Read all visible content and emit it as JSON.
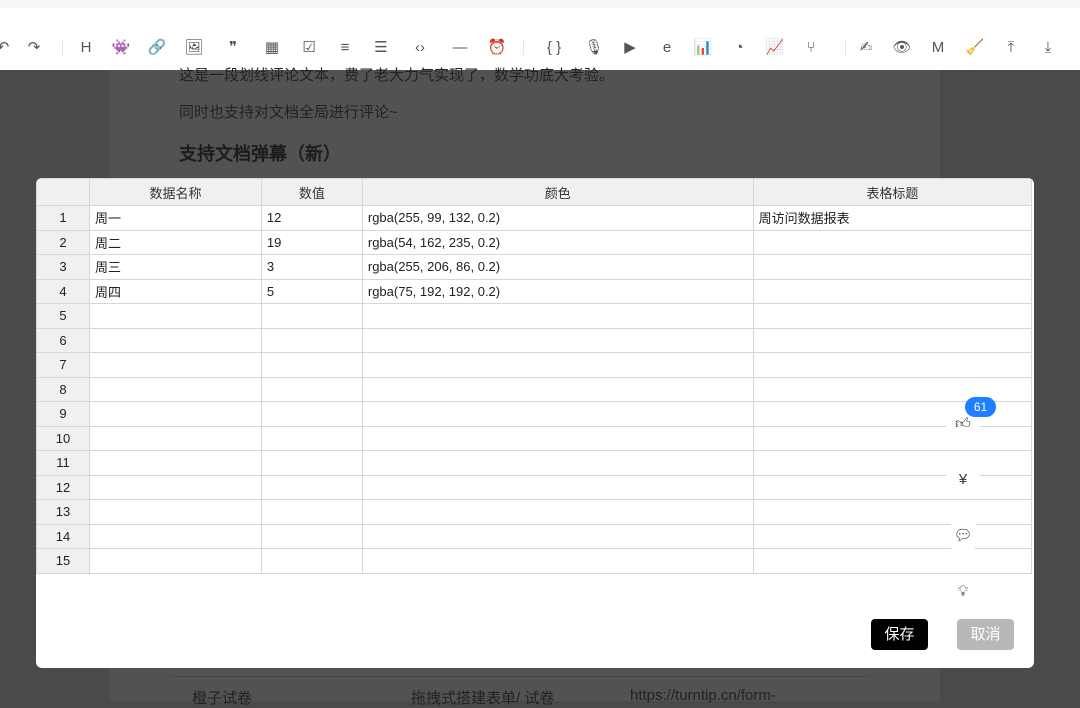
{
  "toolbar": {
    "icons": [
      "undo-icon",
      "redo-icon",
      "heading-icon",
      "emoji-icon",
      "link-icon",
      "image-icon",
      "quote-icon",
      "table-icon",
      "task-list-icon",
      "ordered-list-icon",
      "unordered-list-icon",
      "code-icon",
      "horizontal-rule-icon",
      "alert-icon",
      "code-block-icon",
      "audio-icon",
      "video-icon",
      "browser-icon",
      "bar-chart-icon",
      "pie-chart-icon",
      "line-chart-icon",
      "flowchart-icon",
      "signature-icon",
      "preview-icon",
      "markdown-icon",
      "clear-format-icon",
      "export-icon",
      "import-icon"
    ],
    "heading_label": "H"
  },
  "doc": {
    "line1": "这是一段划线评论文本，费了老大力气实现了，数学功底大考验。",
    "line2": "同时也支持对文档全局进行评论~",
    "heading": "支持文档弹幕（新）",
    "row": [
      "橙子试卷",
      "拖拽式搭建表单/ 试卷",
      "https://turntip.cn/form-"
    ]
  },
  "modal": {
    "columns": [
      "数据名称",
      "数值",
      "颜色",
      "表格标题"
    ],
    "rows": [
      [
        "1",
        "周一",
        "12",
        "rgba(255, 99, 132, 0.2)",
        "周访问数据报表"
      ],
      [
        "2",
        "周二",
        "19",
        "rgba(54, 162, 235, 0.2)",
        ""
      ],
      [
        "3",
        "周三",
        "3",
        "rgba(255, 206, 86, 0.2)",
        ""
      ],
      [
        "4",
        "周四",
        "5",
        "rgba(75, 192, 192, 0.2)",
        ""
      ],
      [
        "5",
        "",
        "",
        "",
        ""
      ],
      [
        "6",
        "",
        "",
        "",
        ""
      ],
      [
        "7",
        "",
        "",
        "",
        ""
      ],
      [
        "8",
        "",
        "",
        "",
        ""
      ],
      [
        "9",
        "",
        "",
        "",
        ""
      ],
      [
        "10",
        "",
        "",
        "",
        ""
      ],
      [
        "11",
        "",
        "",
        "",
        ""
      ],
      [
        "12",
        "",
        "",
        "",
        ""
      ],
      [
        "13",
        "",
        "",
        "",
        ""
      ],
      [
        "14",
        "",
        "",
        "",
        ""
      ],
      [
        "15",
        "",
        "",
        "",
        ""
      ]
    ],
    "save_label": "保存",
    "cancel_label": "取消"
  },
  "floating": {
    "like_count": "61"
  }
}
